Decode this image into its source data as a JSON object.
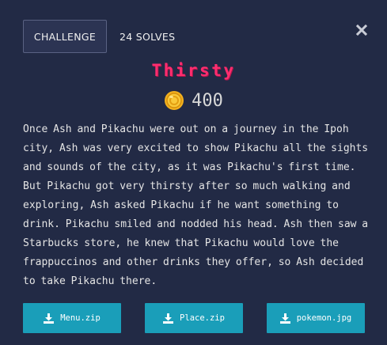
{
  "tabs": {
    "challenge_label": "CHALLENGE",
    "solves_label": "24 SOLVES"
  },
  "challenge": {
    "title": "Thirsty",
    "points": "400",
    "description": "Once Ash and Pikachu were out on a journey in the Ipoh city, Ash was very excited to show Pikachu all the sights and sounds of the city, as it was Pikachu's first time. But Pikachu got very thirsty after so much walking and exploring, Ash asked Pikachu if he want something to drink. Pikachu smiled and nodded his head. Ash then saw a Starbucks store, he knew that Pikachu would love the frappuccinos and other drinks they offer, so Ash decided to take Pikachu there."
  },
  "files": [
    {
      "label": "Menu.zip",
      "icon": "download-icon"
    },
    {
      "label": "Place.zip",
      "icon": "download-icon"
    },
    {
      "label": "pokemon.jpg",
      "icon": "download-icon"
    }
  ],
  "icons": {
    "close": "close-icon",
    "coin": "coin-icon"
  },
  "colors": {
    "background": "#222a45",
    "title": "#ff2d6f",
    "button": "#1a9eb9",
    "coin": "#f2b01e"
  }
}
